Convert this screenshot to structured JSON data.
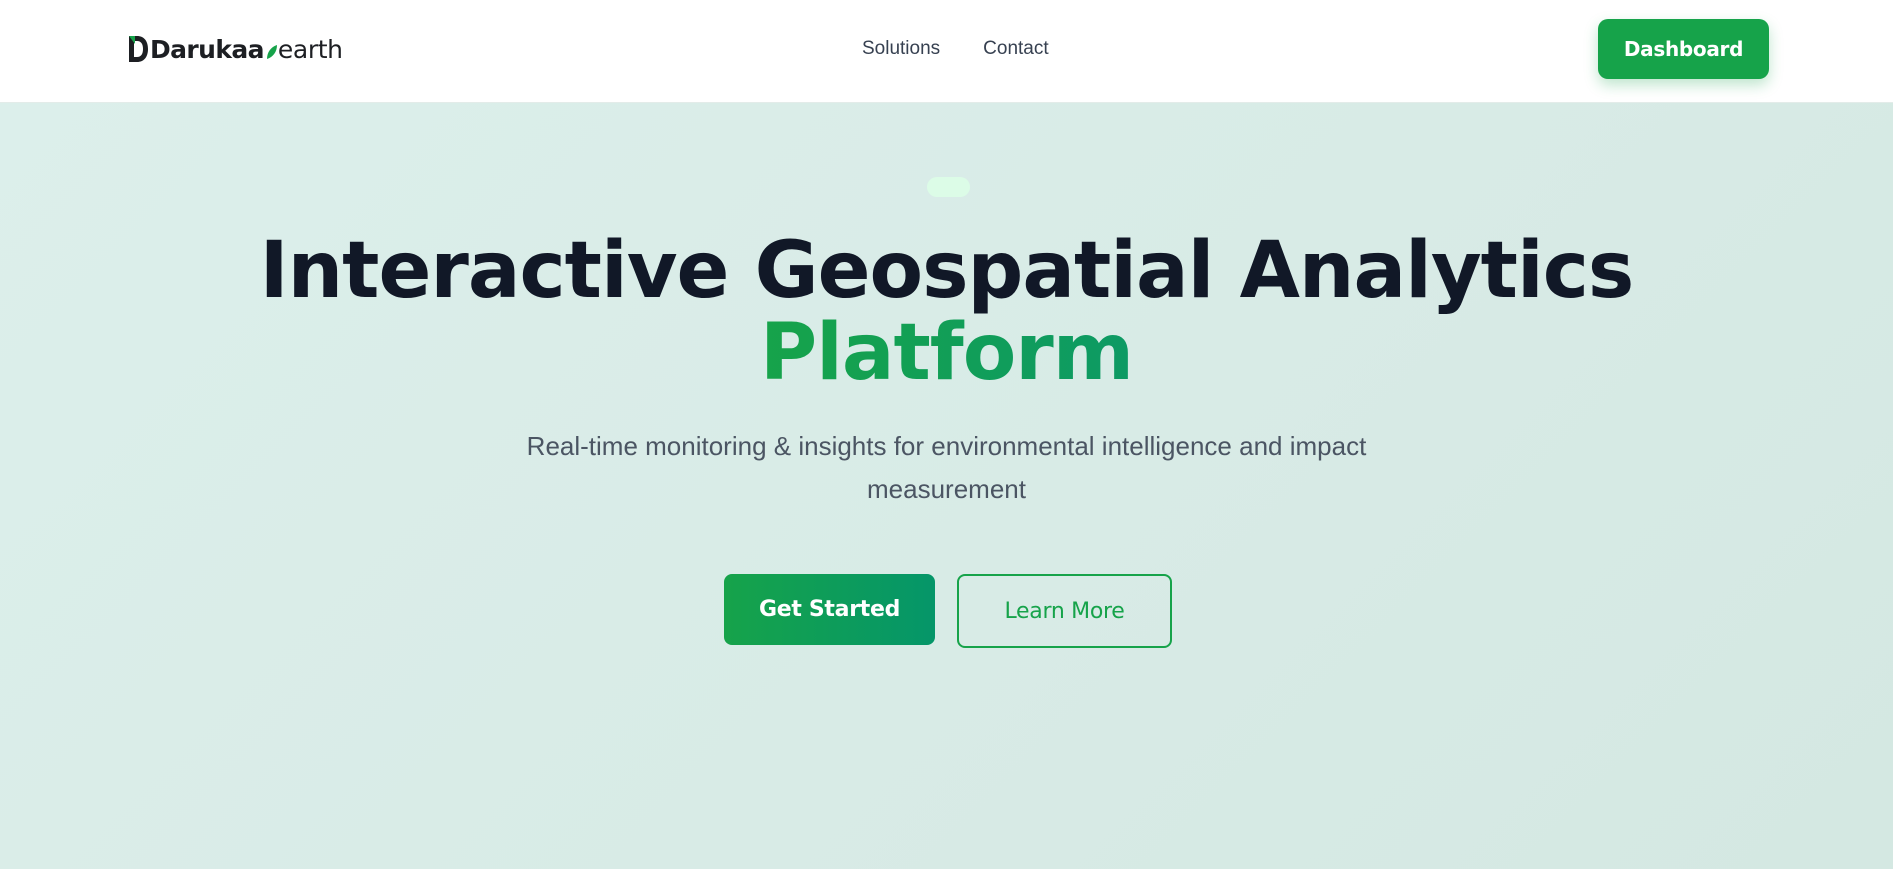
{
  "header": {
    "logo": {
      "word": "Darukaa",
      "tld": "earth",
      "brand_color": "#16a34a"
    },
    "nav": [
      {
        "label": "Solutions"
      },
      {
        "label": "Contact"
      }
    ],
    "dashboard_label": "Dashboard"
  },
  "hero": {
    "title_line1": "Interactive Geospatial Analytics",
    "title_line2": "Platform",
    "subtitle": "Real-time monitoring & insights for environmental intelligence and impact measurement",
    "primary_cta": "Get Started",
    "secondary_cta": "Learn More",
    "accent_color": "#16a34a",
    "background_color": "#d8ebe6"
  }
}
